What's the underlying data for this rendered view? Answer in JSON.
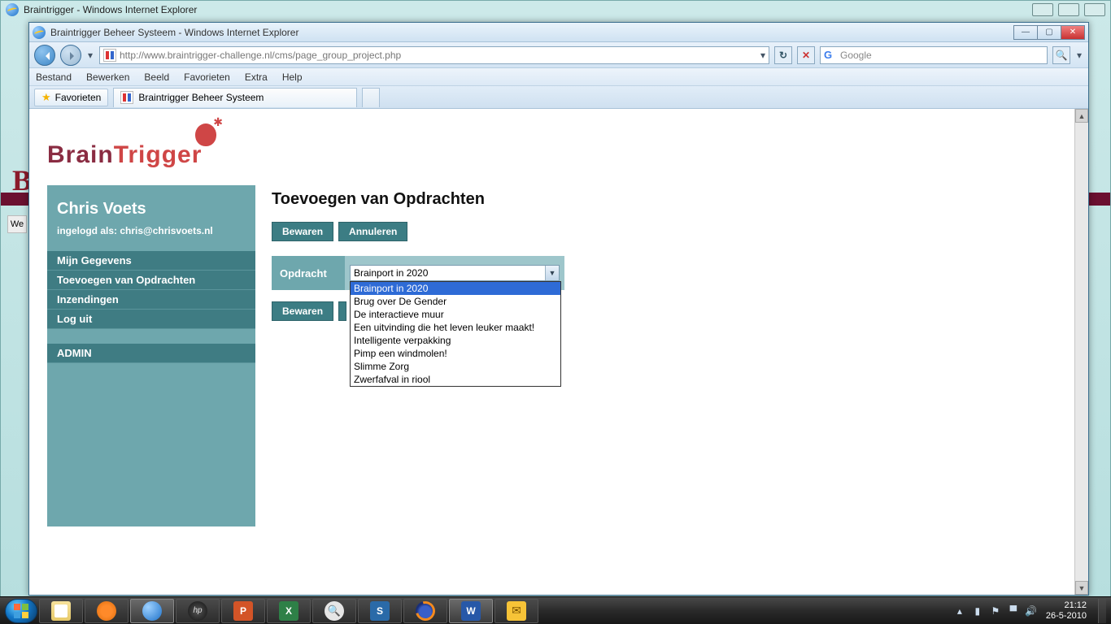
{
  "outer": {
    "title": "Braintrigger - Windows Internet Explorer",
    "bg_letter": "B",
    "bg_tab": "We"
  },
  "inner": {
    "title": "Braintrigger Beheer Systeem - Windows Internet Explorer",
    "url": "http://www.braintrigger-challenge.nl/cms/page_group_project.php",
    "search_placeholder": "Google",
    "menu": {
      "bestand": "Bestand",
      "bewerken": "Bewerken",
      "beeld": "Beeld",
      "favorieten": "Favorieten",
      "extra": "Extra",
      "help": "Help"
    },
    "favorites_button": "Favorieten",
    "tab_label": "Braintrigger Beheer Systeem"
  },
  "logo": {
    "part1": "Brain",
    "part2": "Trigger"
  },
  "sidebar": {
    "username": "Chris Voets",
    "logged_in": "ingelogd als: chris@chrisvoets.nl",
    "items": {
      "gegevens": "Mijn Gegevens",
      "toevoegen": "Toevoegen van Opdrachten",
      "inzendingen": "Inzendingen",
      "loguit": "Log uit",
      "admin": "ADMIN"
    }
  },
  "content": {
    "heading": "Toevoegen van Opdrachten",
    "save": "Bewaren",
    "cancel": "Annuleren",
    "field_label": "Opdracht",
    "selected": "Brainport in 2020",
    "options": {
      "o0": "Brainport in 2020",
      "o1": "Brug over De Gender",
      "o2": "De interactieve muur",
      "o3": "Een uitvinding die het leven leuker maakt!",
      "o4": "Intelligente verpakking",
      "o5": "Pimp een windmolen!",
      "o6": "Slimme Zorg",
      "o7": "Zwerfafval in riool"
    },
    "save2": "Bewaren"
  },
  "taskbar": {
    "time": "21:12",
    "date": "26-5-2010"
  }
}
